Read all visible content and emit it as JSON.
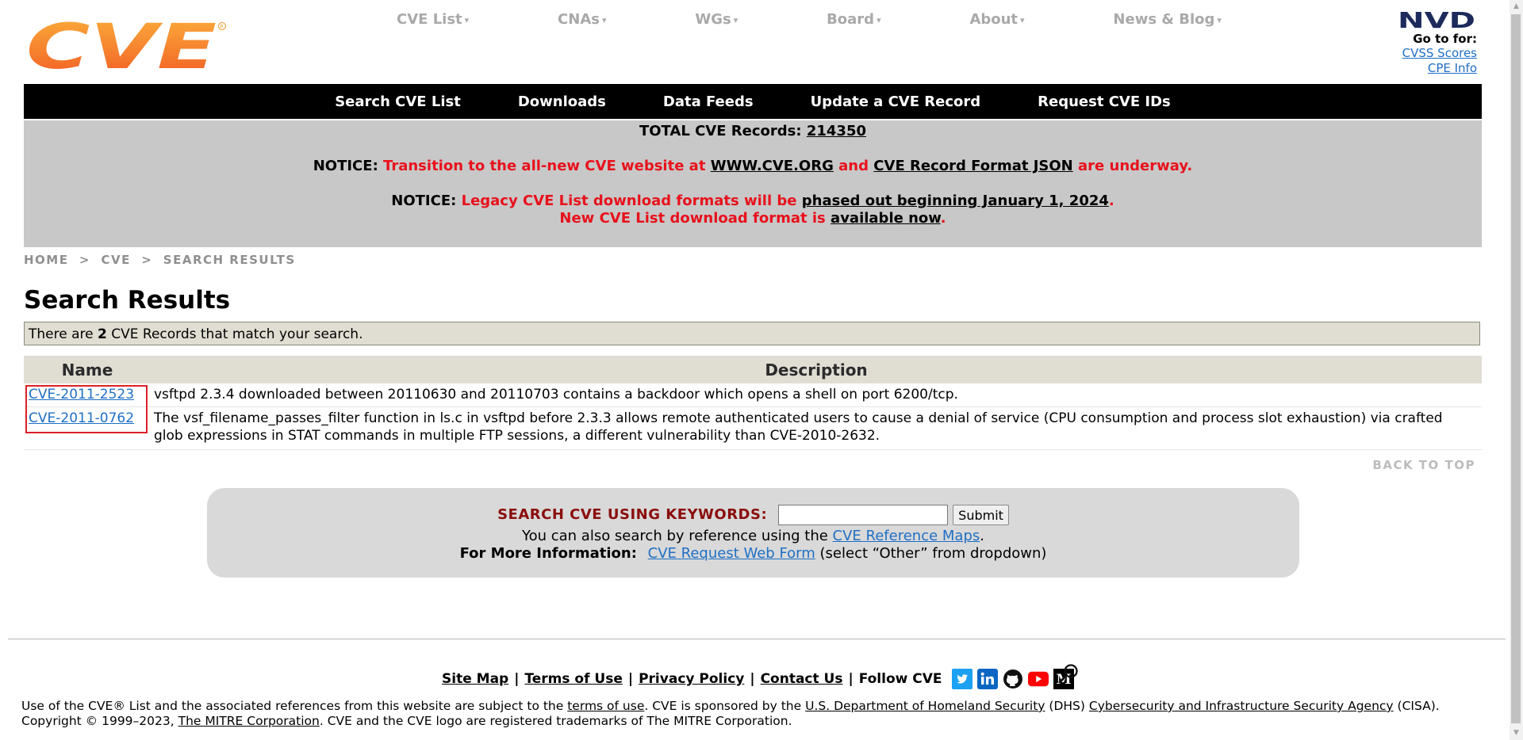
{
  "colors": {
    "brand_orange": "#f7941d",
    "nav_black": "#000000",
    "notice_red": "#e8111c",
    "link_blue": "#1f6fc5",
    "search_label": "#8b0d0d",
    "highlight_red": "#dc2027"
  },
  "top_nav": [
    "CVE List",
    "CNAs",
    "WGs",
    "Board",
    "About",
    "News & Blog"
  ],
  "nvd": {
    "goto": "Go to for:",
    "links": [
      "CVSS Scores",
      "CPE Info"
    ]
  },
  "main_nav": [
    "Search CVE List",
    "Downloads",
    "Data Feeds",
    "Update a CVE Record",
    "Request CVE IDs"
  ],
  "notice": {
    "total_label": "TOTAL CVE Records:",
    "total_value": "214350",
    "n1_label": "NOTICE:",
    "n1_text_a": "Transition to the all-new CVE website at",
    "n1_link_a": "WWW.CVE.ORG",
    "n1_text_b": "and",
    "n1_link_b": "CVE Record Format JSON",
    "n1_text_c": "are underway.",
    "n2_label": "NOTICE:",
    "n2_text_a": "Legacy CVE List download formats will be",
    "n2_link_a": "phased out beginning January 1, 2024",
    "n2_text_b": ".",
    "n2_text_c": "New CVE List download format is",
    "n2_link_b": "available now",
    "n2_text_d": "."
  },
  "breadcrumb": [
    "HOME",
    "CVE",
    "SEARCH RESULTS"
  ],
  "page_title": "Search Results",
  "match": {
    "prefix": "There are",
    "count": "2",
    "suffix": "CVE Records that match your search."
  },
  "table": {
    "headers": {
      "name": "Name",
      "description": "Description"
    },
    "rows": [
      {
        "id": "CVE-2011-2523",
        "description": "vsftpd 2.3.4 downloaded between 20110630 and 20110703 contains a backdoor which opens a shell on port 6200/tcp."
      },
      {
        "id": "CVE-2011-0762",
        "description": "The vsf_filename_passes_filter function in ls.c in vsftpd before 2.3.3 allows remote authenticated users to cause a denial of service (CPU consumption and process slot exhaustion) via crafted glob expressions in STAT commands in multiple FTP sessions, a different vulnerability than CVE-2010-2632."
      }
    ]
  },
  "back_to_top": "BACK TO TOP",
  "search": {
    "label": "SEARCH CVE USING KEYWORDS:",
    "input_value": "",
    "submit": "Submit",
    "ref_prefix": "You can also search by reference using the",
    "ref_link": "CVE Reference Maps",
    "ref_suffix": ".",
    "more_label": "For More Information:",
    "more_link": "CVE Request Web Form",
    "more_suffix": "(select “Other” from dropdown)"
  },
  "footer": {
    "links": [
      "Site Map",
      "Terms of Use",
      "Privacy Policy",
      "Contact Us"
    ],
    "follow": "Follow CVE",
    "social_icons": [
      "twitter-icon",
      "linkedin-icon",
      "github-icon",
      "youtube-icon",
      "medium-icon"
    ],
    "copy_a": "Use of the CVE® List and the associated references from this website are subject to the",
    "copy_link_terms": "terms of use",
    "copy_b": ". CVE is sponsored by the",
    "copy_link_dhs": "U.S. Department of Homeland Security",
    "copy_c": "(DHS)",
    "copy_link_cisa": "Cybersecurity and Infrastructure Security Agency",
    "copy_d": "(CISA). Copyright © 1999–2023,",
    "copy_link_mitre": "The MITRE Corporation",
    "copy_e": ". CVE and the CVE logo are registered trademarks of The MITRE Corporation."
  },
  "logos": {
    "cve": "CVE",
    "nvd": "NVD"
  }
}
